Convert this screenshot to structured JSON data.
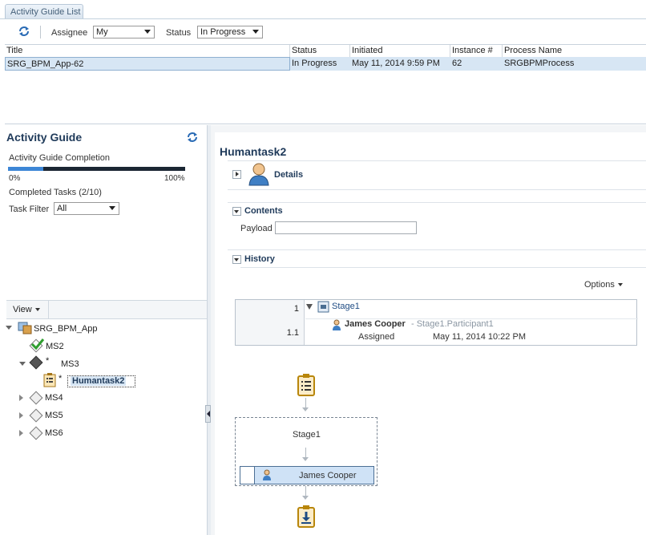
{
  "tab": {
    "label": "Activity Guide List"
  },
  "toolbar": {
    "assignee_label": "Assignee",
    "assignee_value": "My",
    "status_label": "Status",
    "status_value": "In Progress"
  },
  "list": {
    "columns": [
      "Title",
      "Status",
      "Initiated",
      "Instance #",
      "Process Name"
    ],
    "rows": [
      {
        "title": "SRG_BPM_App-62",
        "status": "In Progress",
        "initiated": "May 11, 2014 9:59 PM",
        "instance": "62",
        "process": "SRGBPMProcess"
      }
    ]
  },
  "guide": {
    "title": "Activity Guide",
    "completion_label": "Activity Guide Completion",
    "progress_fraction": 0.2,
    "min_label": "0%",
    "max_label": "100%",
    "completed_tasks": "Completed Tasks  (2/10)",
    "task_filter_label": "Task Filter",
    "task_filter_value": "All",
    "view_label": "View"
  },
  "tree": {
    "root": "SRG_BPM_App",
    "ms2": "MS2",
    "ms3_star": "*",
    "ms3": "MS3",
    "task_star": "*",
    "task": "Humantask2",
    "ms4": "MS4",
    "ms5": "MS5",
    "ms6": "MS6"
  },
  "detail": {
    "title": "Humantask2",
    "details_label": "Details",
    "contents_label": "Contents",
    "payload_label": "Payload",
    "history_label": "History",
    "options_label": "Options"
  },
  "history": {
    "row1_num": "1",
    "row1_stage": "Stage1",
    "row2_num": "1.1",
    "row2_name": "James Cooper",
    "row2_role": "- Stage1.Participant1",
    "row2_action": "Assigned",
    "row2_date": "May 11, 2014 10:22 PM"
  },
  "flow": {
    "stage_label": "Stage1",
    "participant": "James Cooper"
  },
  "colors": {
    "accent": "#1f3a5a",
    "selection": "#d7e6f4",
    "progress": "#3d86d6"
  }
}
